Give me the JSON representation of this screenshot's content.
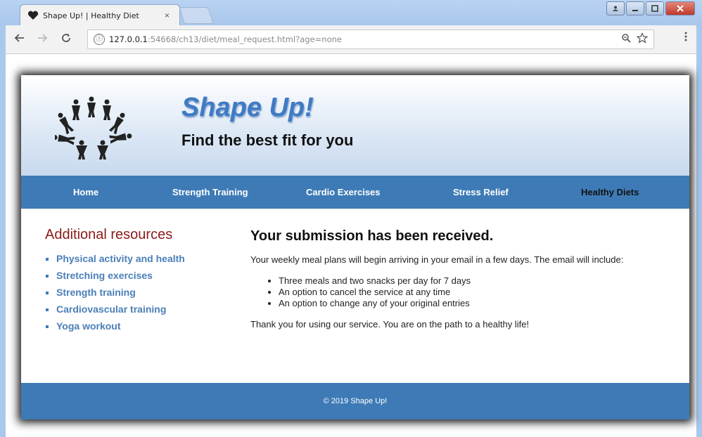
{
  "browser": {
    "tab_title": "Shape Up! | Healthy Diet",
    "tab_close": "×",
    "url_host": "127.0.0.1",
    "url_rest": ":54668/ch13/diet/meal_request.html?age=none",
    "info_icon": "ⓘ"
  },
  "header": {
    "site_title": "Shape Up!",
    "tagline": "Find the best fit for you"
  },
  "nav": {
    "items": [
      {
        "label": "Home"
      },
      {
        "label": "Strength Training"
      },
      {
        "label": "Cardio Exercises"
      },
      {
        "label": "Stress Relief"
      },
      {
        "label": "Healthy Diets"
      }
    ]
  },
  "sidebar": {
    "heading": "Additional resources",
    "links": [
      {
        "label": "Physical activity and health"
      },
      {
        "label": "Stretching exercises"
      },
      {
        "label": "Strength training"
      },
      {
        "label": "Cardiovascular training"
      },
      {
        "label": "Yoga workout"
      }
    ]
  },
  "main": {
    "heading": "Your submission has been received.",
    "intro": "Your weekly meal plans will begin arriving in your email in a few days. The email will include:",
    "bullets": [
      "Three meals and two snacks per day for 7 days",
      "An option to cancel the service at any time",
      "An option to change any of your original entries"
    ],
    "closing": "Thank you for using our service. You are on the path to a healthy life!"
  },
  "footer": {
    "text": "© 2019 Shape Up!"
  },
  "colors": {
    "nav_bg": "#3e7bb6",
    "title_blue": "#3f7bc4",
    "sidebar_heading": "#8b1a1a",
    "link_blue": "#4a7fb8"
  }
}
